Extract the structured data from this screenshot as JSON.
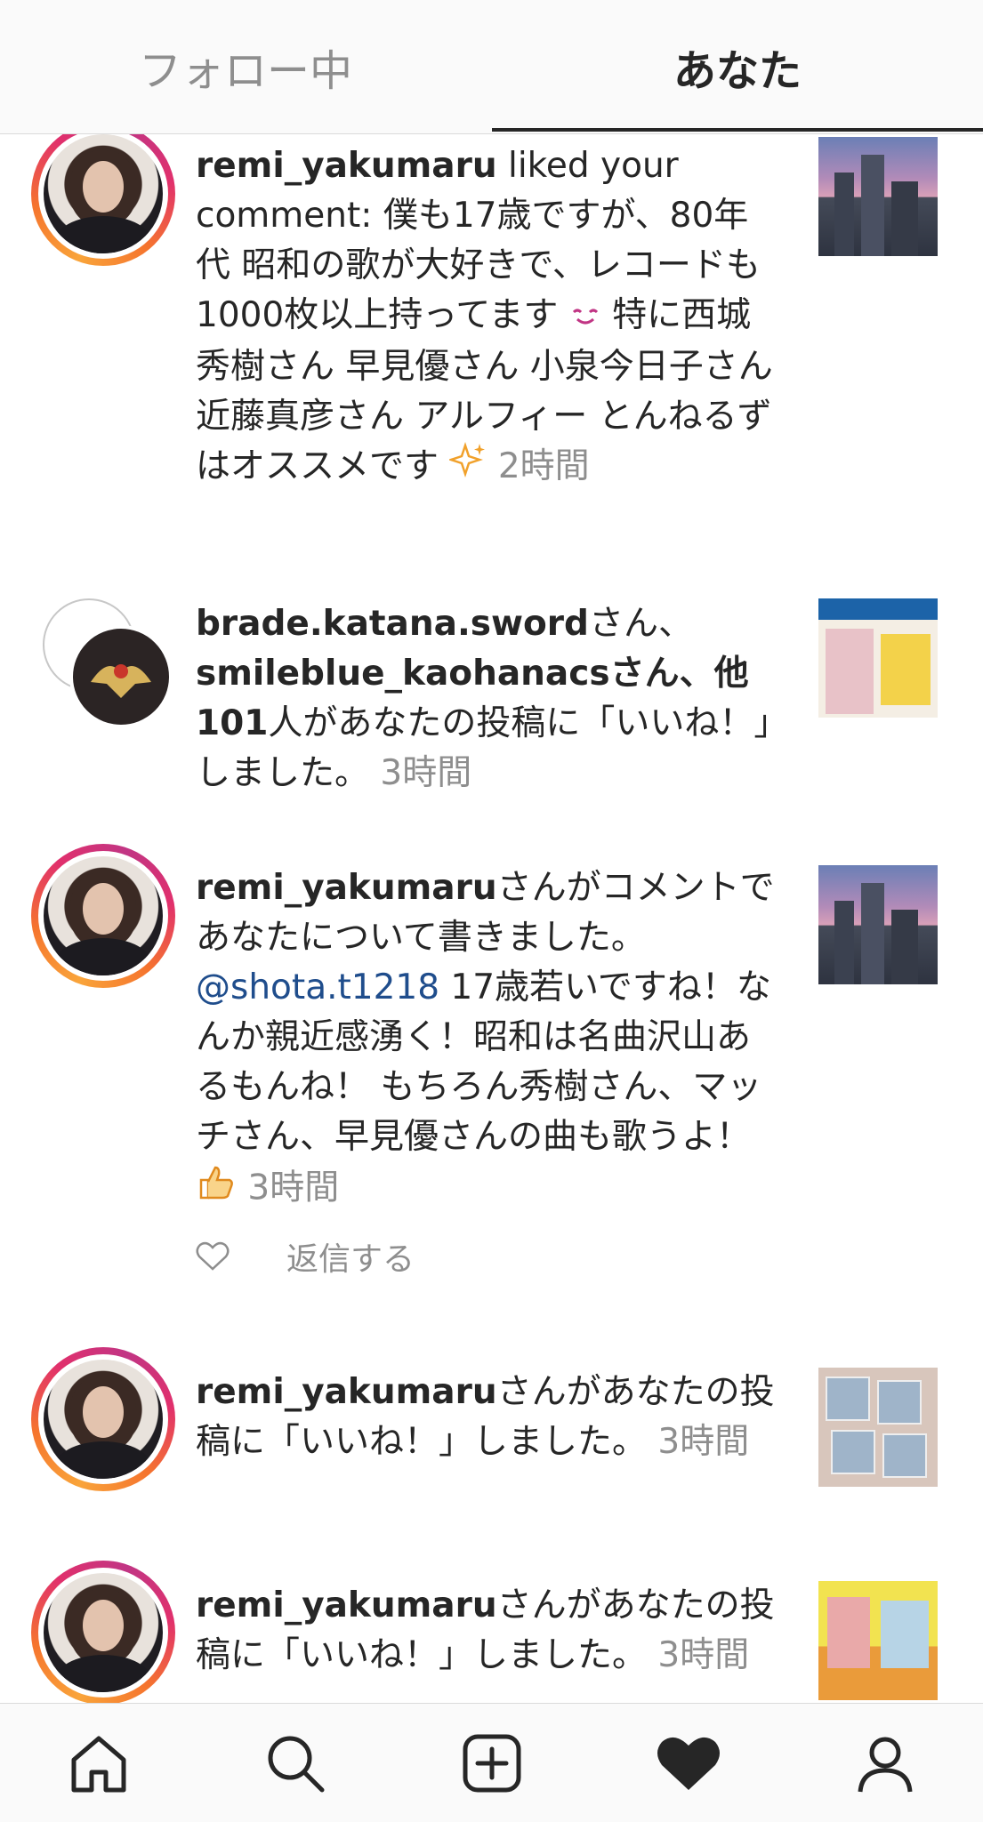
{
  "tabs": {
    "following": "フォロー中",
    "you": "あなた"
  },
  "notifications": [
    {
      "username": "remi_yakumaru",
      "action": " liked your comment: 僕も17歳ですが、80年代 昭和の歌が大好きで、レコードも1000枚以上持ってます",
      "action2": " 特に西城秀樹さん 早見優さん 小泉今日子さん 近藤真彦さん アルフィー とんねるずはオススメです",
      "time": "2時間"
    },
    {
      "username1": "brade.katana.sword",
      "sep1": "さん、",
      "username2": "smileblue_kaohanacs",
      "sep2": "さん、他101",
      "action": "人があなたの投稿に「いいね！」しました。",
      "time": "3時間"
    },
    {
      "username": "remi_yakumaru",
      "action": "さんがコメントであなたについて書きました。",
      "mention": "@shota.t1218",
      "comment": " 17歳若いですね！なんか親近感湧く！昭和は名曲沢山あるもんね！ もちろん秀樹さん、マッチさん、早見優さんの曲も歌うよ！",
      "time": "3時間",
      "reply": "返信する"
    },
    {
      "username": "remi_yakumaru",
      "action": "さんがあなたの投稿に「いいね！」しました。",
      "time": "3時間"
    },
    {
      "username": "remi_yakumaru",
      "action": "さんがあなたの投稿に「いいね！」しました。",
      "time": "3時間"
    }
  ],
  "bottom_nav": [
    "home-icon",
    "search-icon",
    "add-post-icon",
    "activity-heart-icon",
    "profile-icon"
  ]
}
